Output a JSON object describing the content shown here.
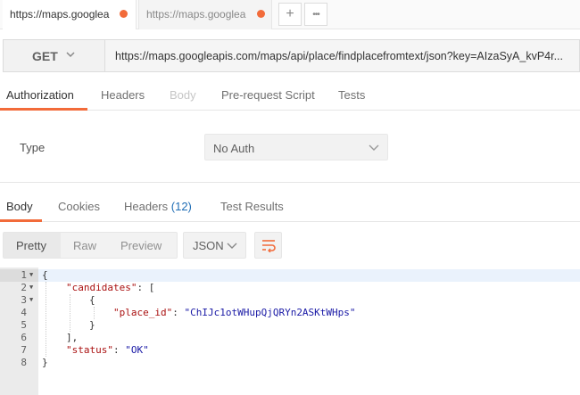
{
  "tabs": [
    {
      "label": "https://maps.googleapis.com/maps",
      "modified": true
    },
    {
      "label": "https://maps.googleapis.com/maps",
      "modified": true
    }
  ],
  "tab_actions": {
    "add": "+",
    "more": "•••"
  },
  "request": {
    "method": "GET",
    "url": "https://maps.googleapis.com/maps/api/place/findplacefromtext/json?key=AIzaSyA_kvP4r..."
  },
  "request_tabs": [
    "Authorization",
    "Headers",
    "Body",
    "Pre-request Script",
    "Tests"
  ],
  "auth": {
    "type_label": "Type",
    "type_value": "No Auth"
  },
  "response_tabs": {
    "body": "Body",
    "cookies": "Cookies",
    "headers": "Headers",
    "headers_count": "(12)",
    "tests": "Test Results"
  },
  "view_modes": [
    "Pretty",
    "Raw",
    "Preview"
  ],
  "format": "JSON",
  "code": {
    "line_numbers": [
      "1",
      "2",
      "3",
      "4",
      "5",
      "6",
      "7",
      "8"
    ],
    "l1": "{",
    "l2_key": "\"candidates\"",
    "l2_rest": ": [",
    "l3": "{",
    "l4_key": "\"place_id\"",
    "l4_sep": ": ",
    "l4_val": "\"ChIJc1otWHupQjQRYn2ASKtWHps\"",
    "l5": "}",
    "l6": "],",
    "l7_key": "\"status\"",
    "l7_sep": ": ",
    "l7_val": "\"OK\"",
    "l8": "}"
  },
  "colors": {
    "accent": "#f26b3a",
    "count": "#1f6db5"
  }
}
